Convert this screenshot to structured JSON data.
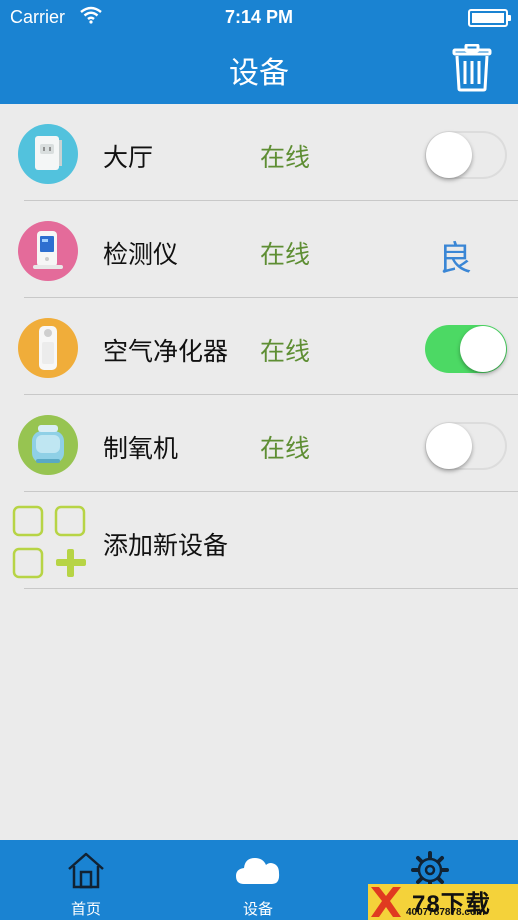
{
  "status_bar": {
    "carrier": "Carrier",
    "time": "7:14 PM"
  },
  "nav": {
    "title": "设备",
    "right_icon": "trash-icon"
  },
  "devices": [
    {
      "name": "大厅",
      "status": "在线",
      "control": "toggle",
      "on": false,
      "icon_color": "#52c2dd"
    },
    {
      "name": "检测仪",
      "status": "在线",
      "control": "quality",
      "quality": "良",
      "icon_color": "#e46b9a"
    },
    {
      "name": "空气净化器",
      "status": "在线",
      "control": "toggle",
      "on": true,
      "icon_color": "#f0ad3a"
    },
    {
      "name": "制氧机",
      "status": "在线",
      "control": "toggle",
      "on": false,
      "icon_color": "#97c451"
    }
  ],
  "add_device": {
    "label": "添加新设备",
    "icon": "add-device-icon"
  },
  "tabs": [
    {
      "label": "首页",
      "icon": "home-icon"
    },
    {
      "label": "设备",
      "icon": "cloud-icon"
    },
    {
      "label": "",
      "icon": "gear-icon"
    }
  ],
  "watermark": {
    "text": "78下载",
    "sub": "4007787878.com"
  },
  "colors": {
    "primary": "#1a83d2",
    "online": "#5e8e33",
    "quality": "#3a86d5",
    "toggle_on": "#4cd964"
  }
}
